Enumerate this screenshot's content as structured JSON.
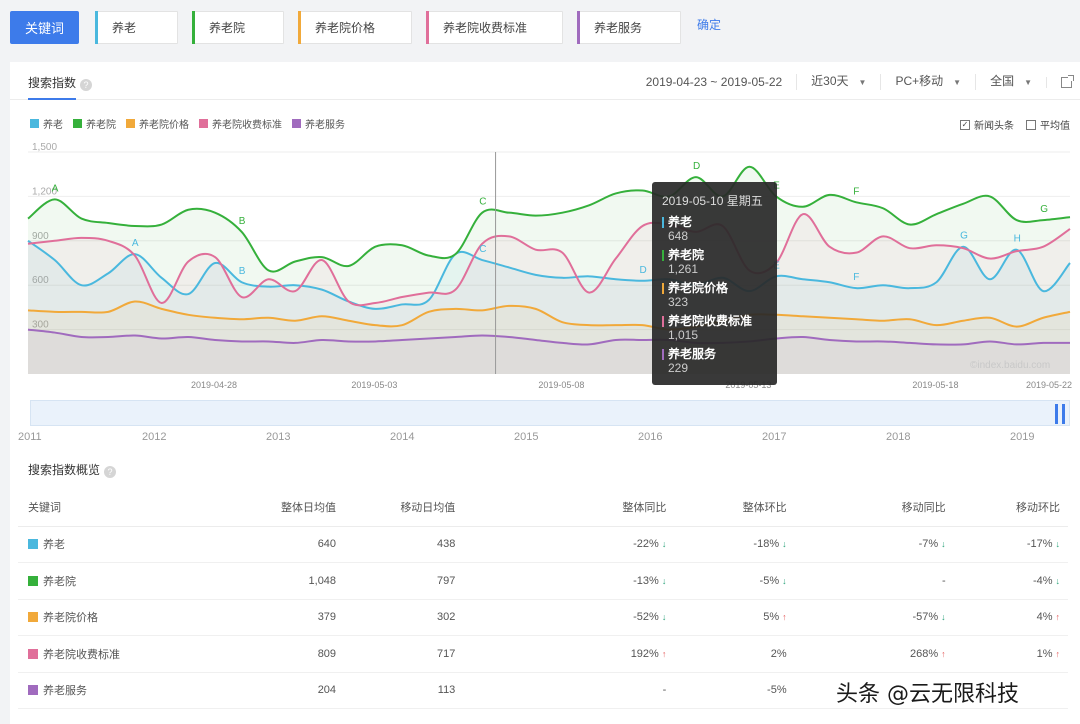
{
  "keywords": {
    "main_label": "关键词",
    "tags": [
      {
        "label": "养老",
        "color": "#4ab8de"
      },
      {
        "label": "养老院",
        "color": "#35b03b"
      },
      {
        "label": "养老院价格",
        "color": "#f1a93a"
      },
      {
        "label": "养老院收费标准",
        "color": "#e06f9a"
      },
      {
        "label": "养老服务",
        "color": "#a06bbe"
      }
    ],
    "confirm_label": "确定"
  },
  "header": {
    "tab_title": "搜索指数",
    "date_range": "2019-04-23 ~ 2019-05-22",
    "period": "近30天",
    "device": "PC+移动",
    "region": "全国"
  },
  "options": {
    "news_label": "新闻头条",
    "avg_label": "平均值"
  },
  "tooltip": {
    "date": "2019-05-10 星期五",
    "items": [
      {
        "name": "养老",
        "value": "648",
        "color": "#4ab8de"
      },
      {
        "name": "养老院",
        "value": "1,261",
        "color": "#35b03b"
      },
      {
        "name": "养老院价格",
        "value": "323",
        "color": "#f1a93a"
      },
      {
        "name": "养老院收费标准",
        "value": "1,015",
        "color": "#e06f9a"
      },
      {
        "name": "养老服务",
        "value": "229",
        "color": "#a06bbe"
      }
    ]
  },
  "chart_data": {
    "type": "line",
    "y_ticks": [
      "1,500",
      "1,200",
      "900",
      "600",
      "300"
    ],
    "ylim": [
      0,
      1500
    ],
    "x_ticks": [
      "2019-04-28",
      "2019-05-03",
      "2019-05-08",
      "2019-05-13",
      "2019-05-18",
      "2019-05-22"
    ],
    "series": [
      {
        "name": "养老",
        "color": "#4ab8de",
        "values": [
          900,
          770,
          600,
          680,
          810,
          650,
          540,
          750,
          620,
          590,
          600,
          570,
          490,
          440,
          470,
          500,
          810,
          770,
          720,
          670,
          650,
          660,
          640,
          630,
          640,
          600,
          650,
          560,
          660,
          640,
          620,
          580,
          600,
          580,
          620,
          860,
          640,
          840,
          560,
          750
        ]
      },
      {
        "name": "养老院",
        "color": "#35b03b",
        "values": [
          1050,
          1180,
          1050,
          1020,
          1000,
          1010,
          1110,
          1090,
          960,
          700,
          760,
          790,
          730,
          860,
          870,
          800,
          810,
          1090,
          1090,
          1070,
          1090,
          1140,
          1220,
          1240,
          1200,
          1330,
          1200,
          1400,
          1200,
          1130,
          1210,
          1160,
          1120,
          1010,
          1080,
          1150,
          1200,
          1040,
          1040,
          1060
        ]
      },
      {
        "name": "养老院价格",
        "color": "#f1a93a",
        "values": [
          430,
          420,
          420,
          420,
          490,
          440,
          400,
          380,
          370,
          380,
          360,
          390,
          360,
          330,
          330,
          420,
          440,
          430,
          460,
          440,
          350,
          330,
          330,
          330,
          300,
          320,
          360,
          400,
          400,
          390,
          380,
          370,
          360,
          370,
          330,
          360,
          380,
          320,
          380,
          420
        ]
      },
      {
        "name": "养老院收费标准",
        "color": "#e06f9a",
        "values": [
          880,
          900,
          920,
          900,
          800,
          480,
          760,
          790,
          520,
          640,
          560,
          770,
          490,
          480,
          520,
          550,
          570,
          880,
          930,
          840,
          820,
          550,
          780,
          1000,
          1010,
          960,
          1000,
          700,
          750,
          1080,
          860,
          820,
          930,
          850,
          870,
          850,
          780,
          830,
          860,
          980
        ]
      },
      {
        "name": "养老服务",
        "color": "#a06bbe",
        "values": [
          300,
          280,
          250,
          250,
          260,
          240,
          250,
          230,
          220,
          220,
          210,
          230,
          220,
          220,
          230,
          240,
          250,
          260,
          250,
          230,
          210,
          200,
          230,
          230,
          230,
          210,
          210,
          220,
          240,
          250,
          230,
          220,
          220,
          210,
          200,
          200,
          220,
          200,
          210,
          210
        ]
      }
    ],
    "annotations": [
      "A",
      "A",
      "B",
      "B",
      "C",
      "C",
      "D",
      "D",
      "E",
      "E",
      "F",
      "F",
      "G",
      "G",
      "H"
    ],
    "watermark": "©index.baidu.com"
  },
  "years": [
    "2011",
    "2012",
    "2013",
    "2014",
    "2015",
    "2016",
    "2017",
    "2018",
    "2019"
  ],
  "overview": {
    "title": "搜索指数概览",
    "columns": [
      "关键词",
      "整体日均值",
      "移动日均值",
      "整体同比",
      "整体环比",
      "移动同比",
      "移动环比"
    ],
    "rows": [
      {
        "name": "养老",
        "color": "#4ab8de",
        "total": "640",
        "mobile": "438",
        "yoy": "-22%",
        "yoy_dir": "down",
        "mom": "-18%",
        "mom_dir": "down",
        "m_yoy": "-7%",
        "m_yoy_dir": "down",
        "m_mom": "-17%",
        "m_mom_dir": "down"
      },
      {
        "name": "养老院",
        "color": "#35b03b",
        "total": "1,048",
        "mobile": "797",
        "yoy": "-13%",
        "yoy_dir": "down",
        "mom": "-5%",
        "mom_dir": "down",
        "m_yoy": "-",
        "m_yoy_dir": "",
        "m_mom": "-4%",
        "m_mom_dir": "down"
      },
      {
        "name": "养老院价格",
        "color": "#f1a93a",
        "total": "379",
        "mobile": "302",
        "yoy": "-52%",
        "yoy_dir": "down",
        "mom": "5%",
        "mom_dir": "up",
        "m_yoy": "-57%",
        "m_yoy_dir": "down",
        "m_mom": "4%",
        "m_mom_dir": "up"
      },
      {
        "name": "养老院收费标准",
        "color": "#e06f9a",
        "total": "809",
        "mobile": "717",
        "yoy": "192%",
        "yoy_dir": "up",
        "mom": "2%",
        "mom_dir": "",
        "m_yoy": "268%",
        "m_yoy_dir": "up",
        "m_mom": "1%",
        "m_mom_dir": "up"
      },
      {
        "name": "养老服务",
        "color": "#a06bbe",
        "total": "204",
        "mobile": "113",
        "yoy": "-",
        "yoy_dir": "",
        "mom": "-5%",
        "mom_dir": "",
        "m_yoy": "",
        "m_yoy_dir": "",
        "m_mom": "",
        "m_mom_dir": ""
      }
    ]
  },
  "watermark_text": "头条 @云无限科技"
}
